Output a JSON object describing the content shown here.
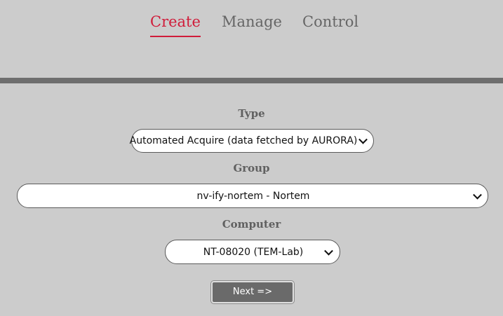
{
  "nav": {
    "tabs": [
      {
        "label": "Create",
        "active": true
      },
      {
        "label": "Manage",
        "active": false
      },
      {
        "label": "Control",
        "active": false
      }
    ]
  },
  "form": {
    "type": {
      "label": "Type",
      "selected": "Automated Acquire (data fetched by AURORA)"
    },
    "group": {
      "label": "Group",
      "selected": "nv-ify-nortem - Nortem"
    },
    "computer": {
      "label": "Computer",
      "selected": "NT-08020 (TEM-Lab)"
    },
    "next_label": "Next =>"
  },
  "colors": {
    "background": "#cccccc",
    "accent": "#d01c3a",
    "divider": "#6e6e6e",
    "button": "#6a6a6a"
  }
}
